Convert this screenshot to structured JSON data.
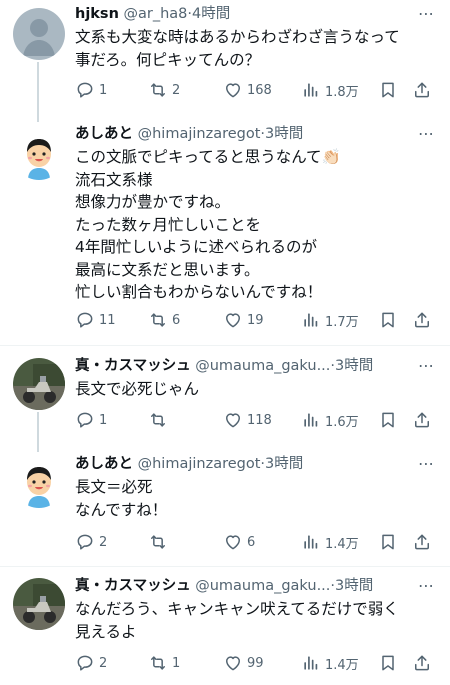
{
  "tweets": [
    {
      "name": "hjksn",
      "handle": "@ar_ha8",
      "time": "4時間",
      "avatar": "default",
      "body": [
        "文系も大変な時はあるからわざわざ言うなって",
        "事だろ。何ピキッてんの？"
      ],
      "replies": "1",
      "retweets": "2",
      "likes": "168",
      "views": "1.8万"
    },
    {
      "name": "あしあと",
      "handle": "@himajinzaregot",
      "time": "3時間",
      "avatar": "boy",
      "body": [
        "この文脈でピキってると思うなんて👏🏻",
        "流石文系様",
        "想像力が豊かですね。",
        "たった数ヶ月忙しいことを",
        "4年間忙しいように述べられるのが",
        "最高に文系だと思います。",
        "忙しい割合もわからないんですね！"
      ],
      "replies": "11",
      "retweets": "6",
      "likes": "19",
      "views": "1.7万"
    },
    {
      "name": "真・カスマッシュ",
      "handle": "@umauma_gaku...",
      "time": "3時間",
      "avatar": "photo",
      "body": [
        "長文で必死じゃん"
      ],
      "replies": "1",
      "retweets": "",
      "likes": "118",
      "views": "1.6万"
    },
    {
      "name": "あしあと",
      "handle": "@himajinzaregot",
      "time": "3時間",
      "avatar": "boy",
      "body": [
        "長文＝必死",
        "なんですね！"
      ],
      "replies": "2",
      "retweets": "",
      "likes": "6",
      "views": "1.4万"
    },
    {
      "name": "真・カスマッシュ",
      "handle": "@umauma_gaku...",
      "time": "3時間",
      "avatar": "photo",
      "body": [
        "なんだろう、キャンキャン吠えてるだけで弱く",
        "見えるよ"
      ],
      "replies": "2",
      "retweets": "1",
      "likes": "99",
      "views": "1.4万"
    }
  ],
  "ui": {
    "dot": "·",
    "more": "⋯"
  },
  "icons": [
    "reply-icon",
    "retweet-icon",
    "like-icon",
    "views-icon",
    "bookmark-icon",
    "share-icon",
    "more-icon"
  ],
  "colors": {
    "text": "#0f1419",
    "muted": "#536471",
    "thread": "#cfd9de",
    "separator": "#eff3f4",
    "avatar_default": "#aab8c2"
  }
}
